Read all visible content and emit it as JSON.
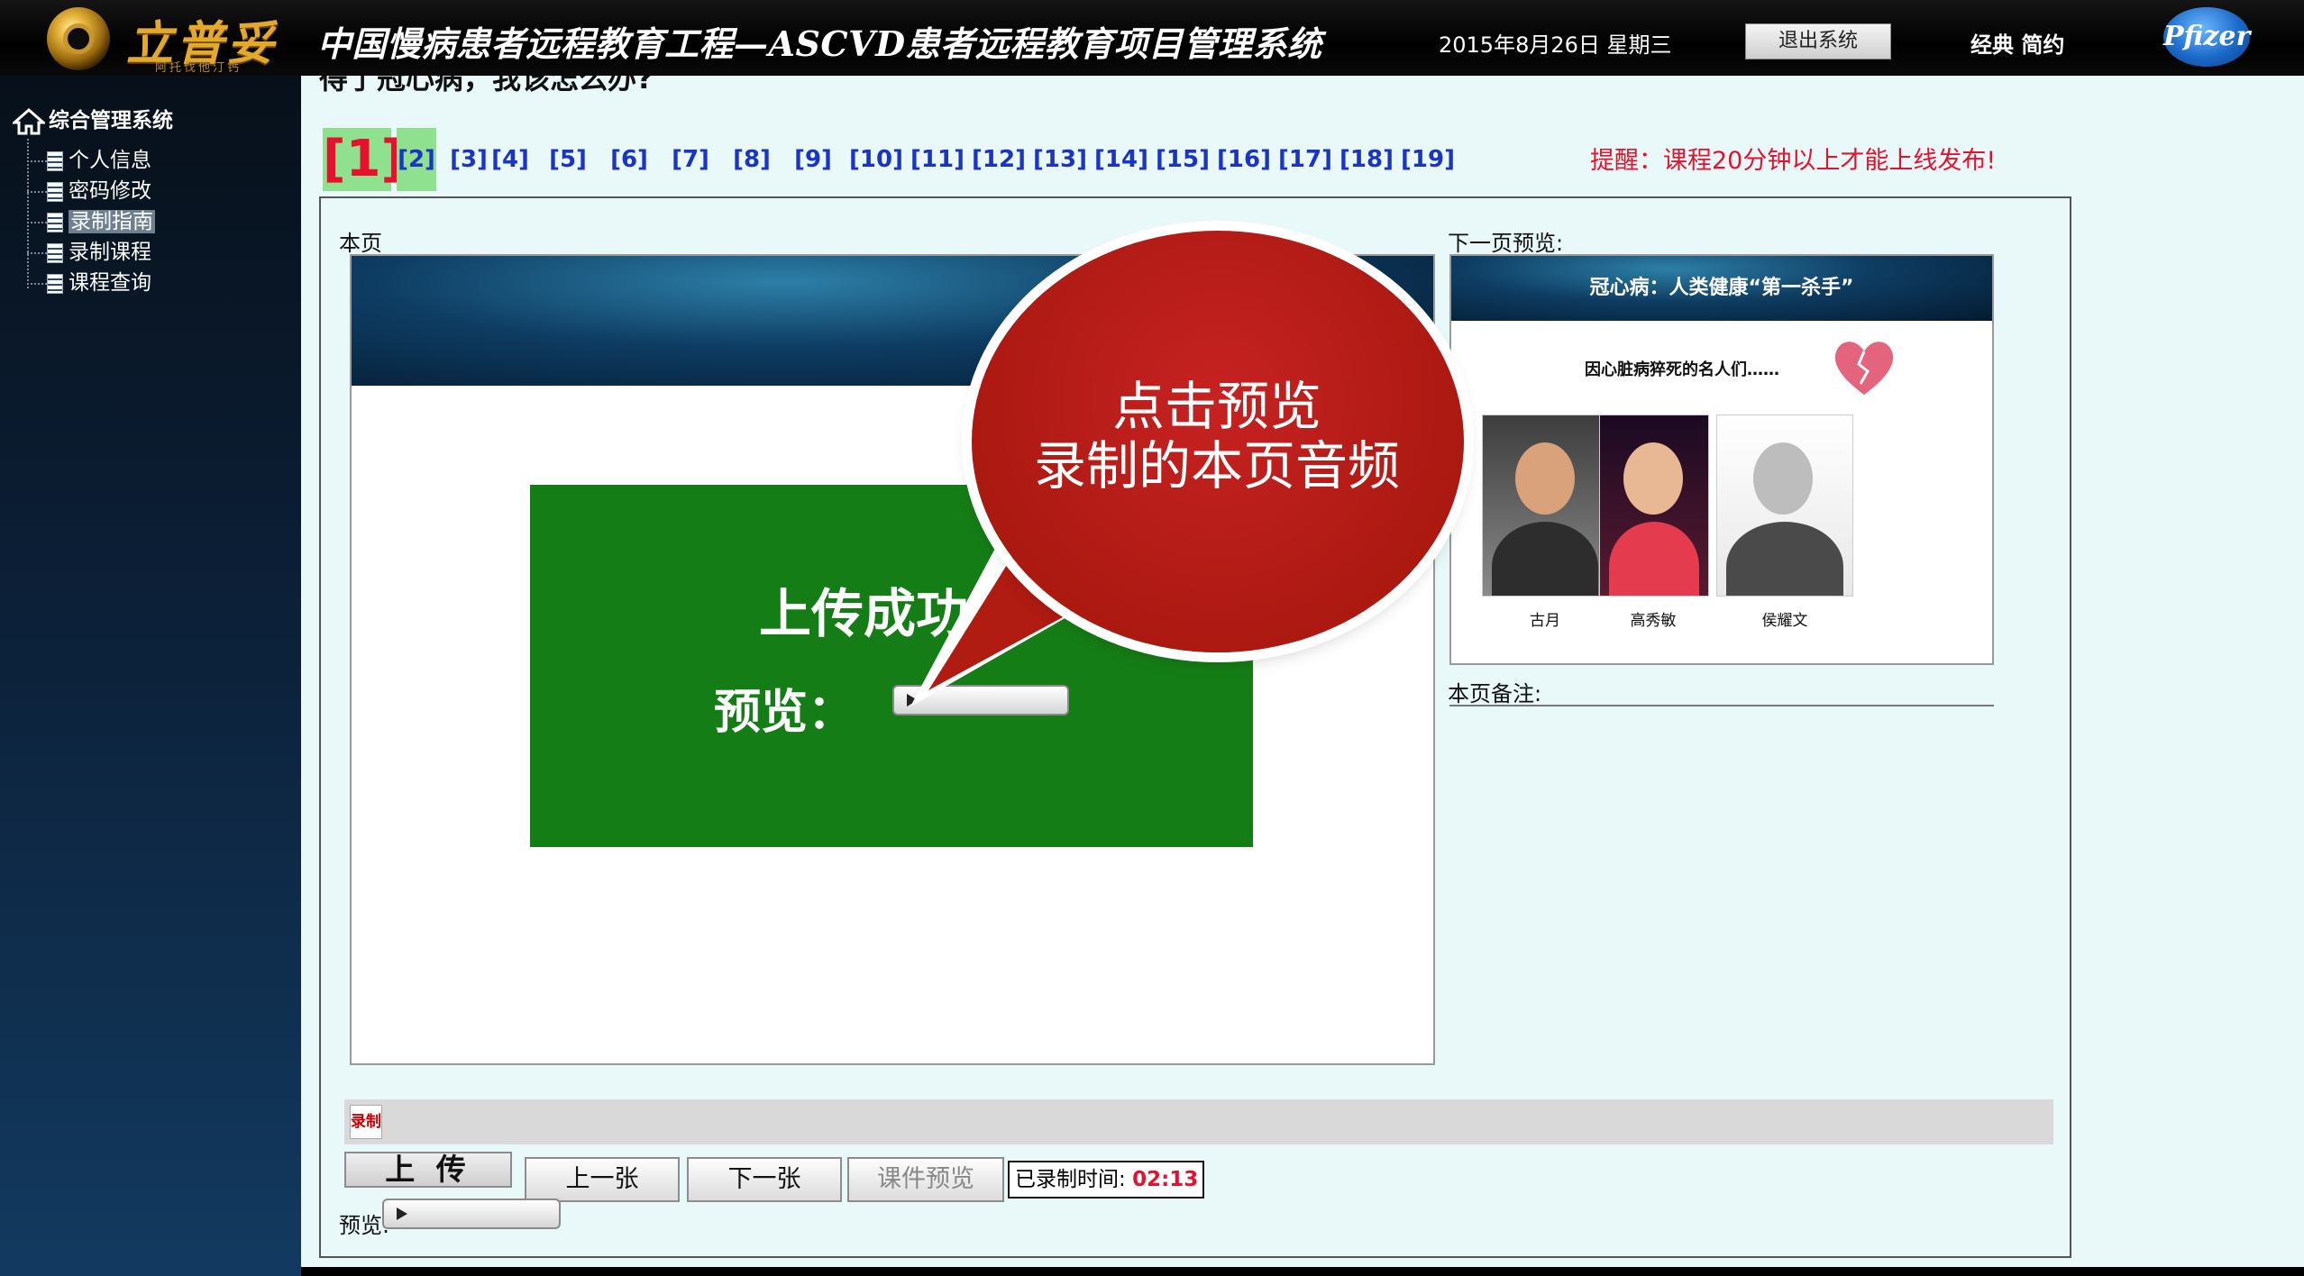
{
  "header": {
    "logo_text": "立普妥",
    "logo_sub": "阿托伐他汀钙",
    "title": "中国慢病患者远程教育工程—ASCVD患者远程教育项目管理系统",
    "date": "2015年8月26日 星期三",
    "exit_label": "退出系统",
    "user": "经典 简约",
    "brand": "Pfizer"
  },
  "sidebar": {
    "root": "综合管理系统",
    "items": [
      {
        "label": "个人信息"
      },
      {
        "label": "密码修改"
      },
      {
        "label": "录制指南",
        "active": true
      },
      {
        "label": "录制课程"
      },
      {
        "label": "课程查询"
      }
    ]
  },
  "main": {
    "cut_title": "得了冠心病，我该怎么办?",
    "pages": [
      "[1]",
      "[2]",
      "[3]",
      "[4]",
      "[5]",
      "[6]",
      "[7]",
      "[8]",
      "[9]",
      "[10]",
      "[11]",
      "[12]",
      "[13]",
      "[14]",
      "[15]",
      "[16]",
      "[17]",
      "[18]",
      "[19]"
    ],
    "current_page": 1,
    "reminder": "提醒：课程20分钟以上才能上线发布!",
    "current_label": "本页",
    "next_label": "下一页预览:",
    "slide": {
      "upload_ok": "上传成功!",
      "preview": "预览："
    },
    "callout": "点击预览\n录制的本页音频",
    "next_slide": {
      "title": "冠心病：人类健康“第一杀手”",
      "subtitle": "因心脏病猝死的名人们……",
      "people": [
        "古月",
        "高秀敏",
        "侯耀文"
      ]
    },
    "notes_label": "本页备注:",
    "record_icon": "录制",
    "upload_btn": "上 传",
    "prev_btn": "上一张",
    "next_btn": "下一张",
    "courseware_btn": "课件预览",
    "recorded_label": "已录制时间:",
    "recorded_time": "02:13",
    "preview_label": "预览:"
  },
  "colors": {
    "header_bg": "#000000",
    "sidebar_bg": "#0c2038",
    "main_bg": "#e9f8f9",
    "accent_red": "#e8112d",
    "link_blue": "#1a34c8",
    "page_highlight": "#8fe08f",
    "slide_green": "#157d16",
    "callout_red": "#b01b12"
  }
}
